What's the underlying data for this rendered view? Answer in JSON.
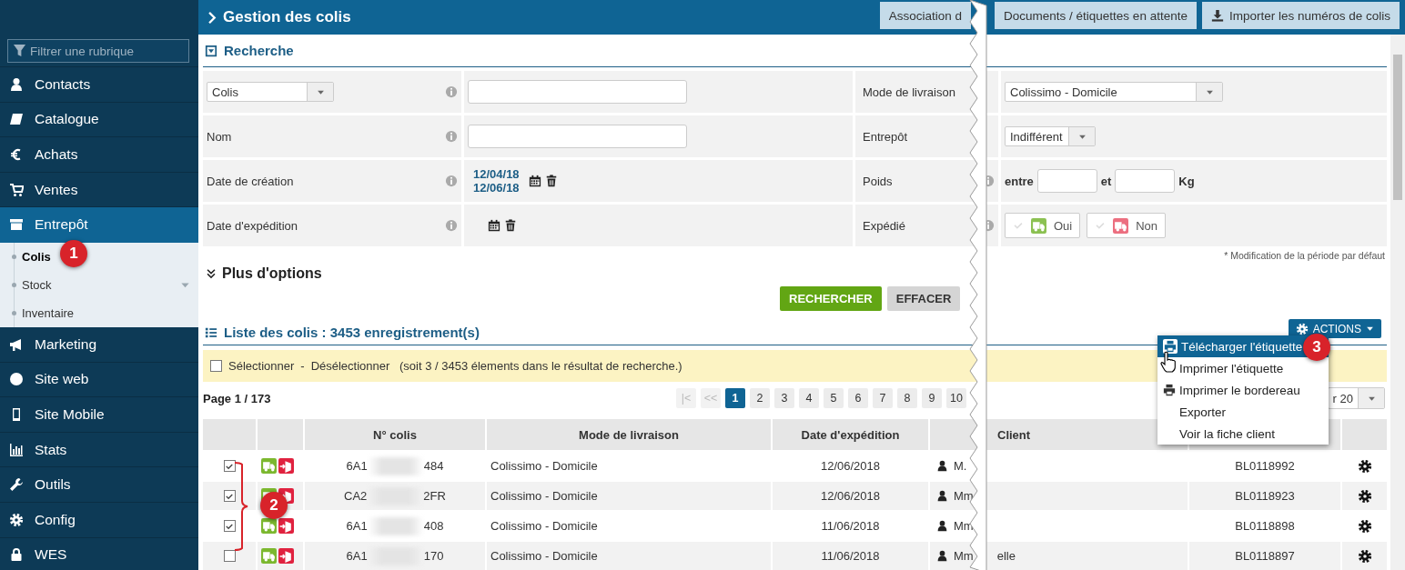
{
  "sidebar": {
    "filter": {
      "placeholder": "Filtrer une rubrique"
    },
    "items": [
      {
        "label": "Contacts",
        "selected": false
      },
      {
        "label": "Catalogue",
        "selected": false
      },
      {
        "label": "Achats",
        "selected": false
      },
      {
        "label": "Ventes",
        "selected": false
      },
      {
        "label": "Entrepôt",
        "selected": true,
        "expanded": true,
        "children": [
          {
            "label": "Colis",
            "selected": true,
            "has_submenu": false
          },
          {
            "label": "Stock",
            "selected": false,
            "has_submenu": true
          },
          {
            "label": "Inventaire",
            "selected": false,
            "has_submenu": false
          }
        ]
      },
      {
        "label": "Marketing",
        "selected": false
      },
      {
        "label": "Site web",
        "selected": false
      },
      {
        "label": "Site Mobile",
        "selected": false
      },
      {
        "label": "Stats",
        "selected": false
      },
      {
        "label": "Outils",
        "selected": false
      },
      {
        "label": "Config",
        "selected": false
      },
      {
        "label": "WES",
        "selected": false
      }
    ]
  },
  "header": {
    "title": "Gestion des colis",
    "buttons": [
      {
        "label": "Association d",
        "kind": "plain"
      },
      {
        "label": "Documents / étiquettes en attente",
        "kind": "plain"
      },
      {
        "label": "Importer les numéros de colis",
        "kind": "import"
      }
    ]
  },
  "search": {
    "title": "Recherche",
    "rows": [
      {
        "left": {
          "kind": "select",
          "value": "Colis",
          "info": true
        },
        "middle": {
          "kind": "input"
        },
        "label": "Mode de livraison",
        "right": {
          "kind": "select",
          "value": "Colissimo - Domicile",
          "info": false
        }
      },
      {
        "left": {
          "kind": "label",
          "value": "Nom",
          "info": true
        },
        "middle": {
          "kind": "input"
        },
        "label": "Entrepôt",
        "right": {
          "kind": "select",
          "value": "Indifférent",
          "info": false
        }
      },
      {
        "left": {
          "kind": "label",
          "value": "Date de création",
          "info": true
        },
        "middle": {
          "kind": "dates",
          "dates": [
            "12/04/18",
            "12/06/18"
          ]
        },
        "label": "Poids",
        "right": {
          "kind": "range",
          "from": "entre",
          "to": "et",
          "unit": "Kg",
          "info": true
        }
      },
      {
        "left": {
          "kind": "label",
          "value": "Date d'expédition",
          "info": true
        },
        "middle": {
          "kind": "dates"
        },
        "label": "Expédié",
        "right": {
          "kind": "toggles",
          "info": true,
          "options": [
            {
              "label": "Oui",
              "checked": false,
              "color": "#8cc152"
            },
            {
              "label": "Non",
              "checked": false,
              "color": "#ec6f80"
            }
          ]
        }
      }
    ],
    "note": "* Modification de la période par défaut",
    "more_options": "Plus d'options",
    "buttons": [
      {
        "label": "RECHERCHER",
        "kind": "primary"
      },
      {
        "label": "EFFACER",
        "kind": "secondary"
      }
    ]
  },
  "results": {
    "title": "Liste des colis : 3453 enregistrement(s)",
    "actions": "ACTIONS",
    "selection_bar": {
      "checked": false,
      "select": "Sélectionner",
      "separator": "-",
      "deselect": "Désélectionner",
      "summary": "(soit 3 / 3453 élements dans le résultat de recherche.)"
    },
    "page_label": "Page 1 / 173",
    "pagination": {
      "first": "|<",
      "prev": "<<",
      "pages": [
        {
          "label": "1",
          "selected": true
        },
        {
          "label": "2",
          "selected": false
        },
        {
          "label": "3",
          "selected": false
        },
        {
          "label": "4",
          "selected": false
        },
        {
          "label": "5",
          "selected": false
        },
        {
          "label": "6",
          "selected": false
        },
        {
          "label": "7",
          "selected": false
        },
        {
          "label": "8",
          "selected": false
        },
        {
          "label": "9",
          "selected": false
        },
        {
          "label": "10",
          "selected": false
        }
      ]
    },
    "per_page": "r 20",
    "columns": [
      "N° colis",
      "Mode de livraison",
      "Date d'expédition",
      "Client"
    ],
    "rows": [
      {
        "checked": true,
        "colis_start": "6A1",
        "colis_end": "484",
        "mode": "Colissimo - Domicile",
        "date": "12/06/2018",
        "client": "M.",
        "bl": "BL0118992"
      },
      {
        "checked": true,
        "colis_start": "CA2",
        "colis_end": "2FR",
        "mode": "Colissimo - Domicile",
        "date": "12/06/2018",
        "client": "Mm",
        "bl": "BL0118923"
      },
      {
        "checked": true,
        "colis_start": "6A1",
        "colis_end": "408",
        "mode": "Colissimo - Domicile",
        "date": "11/06/2018",
        "client": "Mm",
        "bl": "BL0118898"
      },
      {
        "checked": false,
        "colis_start": "6A1",
        "colis_end": "170",
        "mode": "Colissimo - Domicile",
        "date": "11/06/2018",
        "client": "Mm",
        "client_tail": "elle",
        "bl": "BL0118897"
      }
    ]
  },
  "actions_menu": {
    "items": [
      {
        "label": "Télécharger l'étiquette",
        "selected": true,
        "printer": true
      },
      {
        "label": "Imprimer l'étiquette",
        "selected": false,
        "printer": false
      },
      {
        "label": "Imprimer le bordereau",
        "selected": false,
        "printer": true
      },
      {
        "label": "Exporter",
        "selected": false,
        "printer": false
      },
      {
        "label": "Voir la fiche client",
        "selected": false,
        "printer": false
      }
    ]
  },
  "callouts": [
    "1",
    "2",
    "3"
  ]
}
